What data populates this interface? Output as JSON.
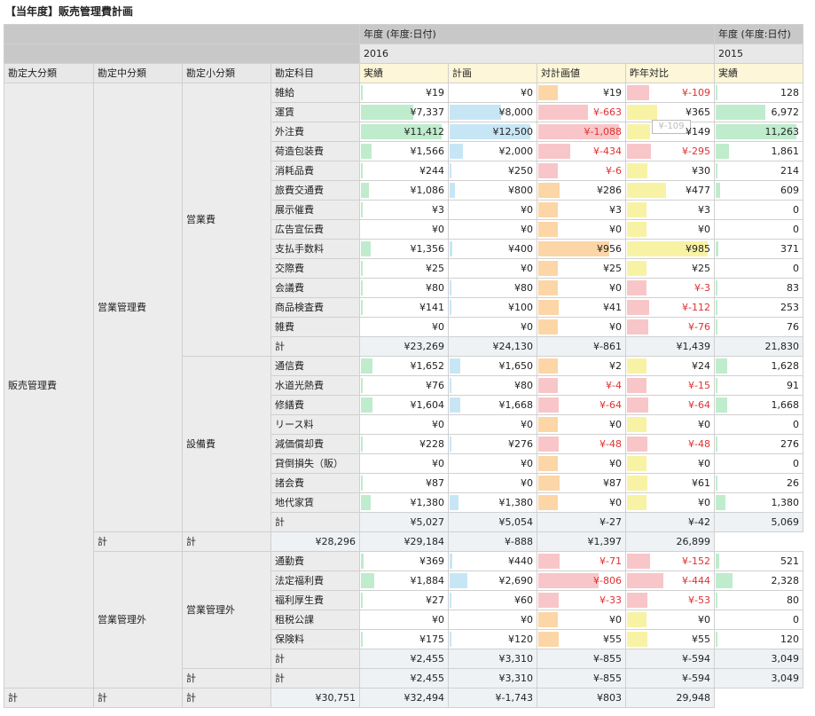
{
  "title": "【当年度】販売管理費計画",
  "header": {
    "year_label": "年度 (年度:日付)",
    "year_2016": "2016",
    "year_2015": "2015",
    "dims": [
      "勘定大分類",
      "勘定中分類",
      "勘定小分類",
      "勘定科目"
    ],
    "cols_2016": [
      "実績",
      "計画",
      "対計画値",
      "昨年対比"
    ],
    "cols_2015": [
      "実績"
    ]
  },
  "groups": {
    "large": "販売管理費",
    "mid1": "営業管理費",
    "mid2": "営業管理外",
    "small1": "営業費",
    "small2": "設備費",
    "small3": "営業管理外",
    "kei": "計"
  },
  "tooltip": "¥-109",
  "rows": [
    {
      "acct": "雑給",
      "actual": "¥19",
      "plan": "¥0",
      "vsplan": "¥19",
      "yoy": "¥-109",
      "ly": "128"
    },
    {
      "acct": "運賃",
      "actual": "¥7,337",
      "plan": "¥8,000",
      "vsplan": "¥-663",
      "yoy": "¥365",
      "ly": "6,972"
    },
    {
      "acct": "外注費",
      "actual": "¥11,412",
      "plan": "¥12,500",
      "vsplan": "¥-1,088",
      "yoy": "¥149",
      "ly": "11,263"
    },
    {
      "acct": "荷造包装費",
      "actual": "¥1,566",
      "plan": "¥2,000",
      "vsplan": "¥-434",
      "yoy": "¥-295",
      "ly": "1,861"
    },
    {
      "acct": "消耗品費",
      "actual": "¥244",
      "plan": "¥250",
      "vsplan": "¥-6",
      "yoy": "¥30",
      "ly": "214"
    },
    {
      "acct": "旅費交通費",
      "actual": "¥1,086",
      "plan": "¥800",
      "vsplan": "¥286",
      "yoy": "¥477",
      "ly": "609"
    },
    {
      "acct": "展示催費",
      "actual": "¥3",
      "plan": "¥0",
      "vsplan": "¥3",
      "yoy": "¥3",
      "ly": "0"
    },
    {
      "acct": "広告宣伝費",
      "actual": "¥0",
      "plan": "¥0",
      "vsplan": "¥0",
      "yoy": "¥0",
      "ly": "0"
    },
    {
      "acct": "支払手数料",
      "actual": "¥1,356",
      "plan": "¥400",
      "vsplan": "¥956",
      "yoy": "¥985",
      "ly": "371"
    },
    {
      "acct": "交際費",
      "actual": "¥25",
      "plan": "¥0",
      "vsplan": "¥25",
      "yoy": "¥25",
      "ly": "0"
    },
    {
      "acct": "会議費",
      "actual": "¥80",
      "plan": "¥80",
      "vsplan": "¥0",
      "yoy": "¥-3",
      "ly": "83"
    },
    {
      "acct": "商品検査費",
      "actual": "¥141",
      "plan": "¥100",
      "vsplan": "¥41",
      "yoy": "¥-112",
      "ly": "253"
    },
    {
      "acct": "雑費",
      "actual": "¥0",
      "plan": "¥0",
      "vsplan": "¥0",
      "yoy": "¥-76",
      "ly": "76"
    },
    {
      "acct": "計",
      "actual": "¥23,269",
      "plan": "¥24,130",
      "vsplan": "¥-861",
      "yoy": "¥1,439",
      "ly": "21,830",
      "total": true
    },
    {
      "acct": "通信費",
      "actual": "¥1,652",
      "plan": "¥1,650",
      "vsplan": "¥2",
      "yoy": "¥24",
      "ly": "1,628"
    },
    {
      "acct": "水道光熱費",
      "actual": "¥76",
      "plan": "¥80",
      "vsplan": "¥-4",
      "yoy": "¥-15",
      "ly": "91"
    },
    {
      "acct": "修繕費",
      "actual": "¥1,604",
      "plan": "¥1,668",
      "vsplan": "¥-64",
      "yoy": "¥-64",
      "ly": "1,668"
    },
    {
      "acct": "リース料",
      "actual": "¥0",
      "plan": "¥0",
      "vsplan": "¥0",
      "yoy": "¥0",
      "ly": "0"
    },
    {
      "acct": "減価償却費",
      "actual": "¥228",
      "plan": "¥276",
      "vsplan": "¥-48",
      "yoy": "¥-48",
      "ly": "276"
    },
    {
      "acct": "貸倒損失（販）",
      "actual": "¥0",
      "plan": "¥0",
      "vsplan": "¥0",
      "yoy": "¥0",
      "ly": "0"
    },
    {
      "acct": "諸会費",
      "actual": "¥87",
      "plan": "¥0",
      "vsplan": "¥87",
      "yoy": "¥61",
      "ly": "26"
    },
    {
      "acct": "地代家賃",
      "actual": "¥1,380",
      "plan": "¥1,380",
      "vsplan": "¥0",
      "yoy": "¥0",
      "ly": "1,380"
    },
    {
      "acct": "計",
      "actual": "¥5,027",
      "plan": "¥5,054",
      "vsplan": "¥-27",
      "yoy": "¥-42",
      "ly": "5,069",
      "total": true
    },
    {
      "acct": "計",
      "actual": "¥28,296",
      "plan": "¥29,184",
      "vsplan": "¥-888",
      "yoy": "¥1,397",
      "ly": "26,899",
      "total": true
    },
    {
      "acct": "通勤費",
      "actual": "¥369",
      "plan": "¥440",
      "vsplan": "¥-71",
      "yoy": "¥-152",
      "ly": "521"
    },
    {
      "acct": "法定福利費",
      "actual": "¥1,884",
      "plan": "¥2,690",
      "vsplan": "¥-806",
      "yoy": "¥-444",
      "ly": "2,328"
    },
    {
      "acct": "福利厚生費",
      "actual": "¥27",
      "plan": "¥60",
      "vsplan": "¥-33",
      "yoy": "¥-53",
      "ly": "80"
    },
    {
      "acct": "租税公課",
      "actual": "¥0",
      "plan": "¥0",
      "vsplan": "¥0",
      "yoy": "¥0",
      "ly": "0"
    },
    {
      "acct": "保険料",
      "actual": "¥175",
      "plan": "¥120",
      "vsplan": "¥55",
      "yoy": "¥55",
      "ly": "120"
    },
    {
      "acct": "計",
      "actual": "¥2,455",
      "plan": "¥3,310",
      "vsplan": "¥-855",
      "yoy": "¥-594",
      "ly": "3,049",
      "total": true
    },
    {
      "acct": "計",
      "actual": "¥2,455",
      "plan": "¥3,310",
      "vsplan": "¥-855",
      "yoy": "¥-594",
      "ly": "3,049",
      "total": true
    },
    {
      "acct": "計",
      "actual": "¥30,751",
      "plan": "¥32,494",
      "vsplan": "¥-1,743",
      "yoy": "¥803",
      "ly": "29,948",
      "total": true
    }
  ]
}
